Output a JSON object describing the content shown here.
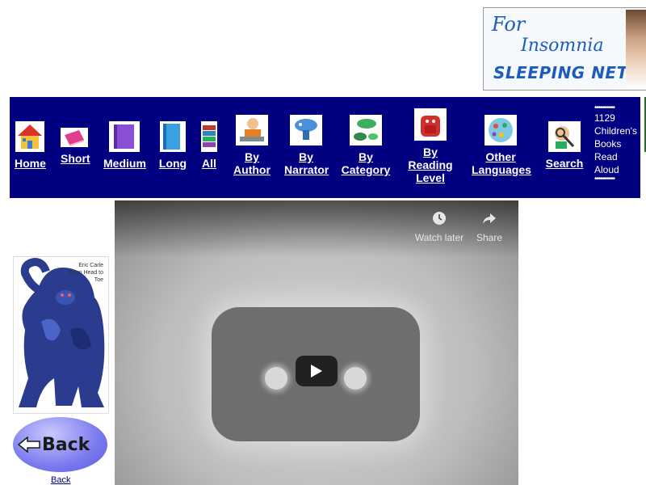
{
  "ad": {
    "line1": "For",
    "line2": "Insomnia",
    "line3": "SLEEPING NET"
  },
  "nav": {
    "items": [
      {
        "label": "Home",
        "icon": "house-icon"
      },
      {
        "label": "Short",
        "icon": "pink-book-icon"
      },
      {
        "label": "Medium",
        "icon": "purple-book-icon"
      },
      {
        "label": "Long",
        "icon": "blue-book-icon"
      },
      {
        "label": "All",
        "icon": "book-stack-icon"
      },
      {
        "label": "By Author",
        "icon": "author-icon"
      },
      {
        "label": "By Narrator",
        "icon": "narrator-icon"
      },
      {
        "label": "By Category",
        "icon": "category-icon"
      },
      {
        "label": "By Reading Level",
        "icon": "backpack-icon"
      },
      {
        "label": "Other Languages",
        "icon": "globe-icon"
      },
      {
        "label": "Search",
        "icon": "search-icon"
      }
    ],
    "count_line1": "1129",
    "count_line2": "Children's",
    "count_line3": "Books",
    "count_line4": "Read",
    "count_line5": "Aloud",
    "dots": "••••••••••"
  },
  "book": {
    "author": "Eric Carle",
    "title": "From Head to Toe"
  },
  "back": {
    "button_label": "Back",
    "link_label": "Back"
  },
  "video": {
    "watch_later": "Watch later",
    "share": "Share"
  },
  "colors": {
    "nav_bg": "#000080",
    "ad_text": "#1d5bbf"
  }
}
